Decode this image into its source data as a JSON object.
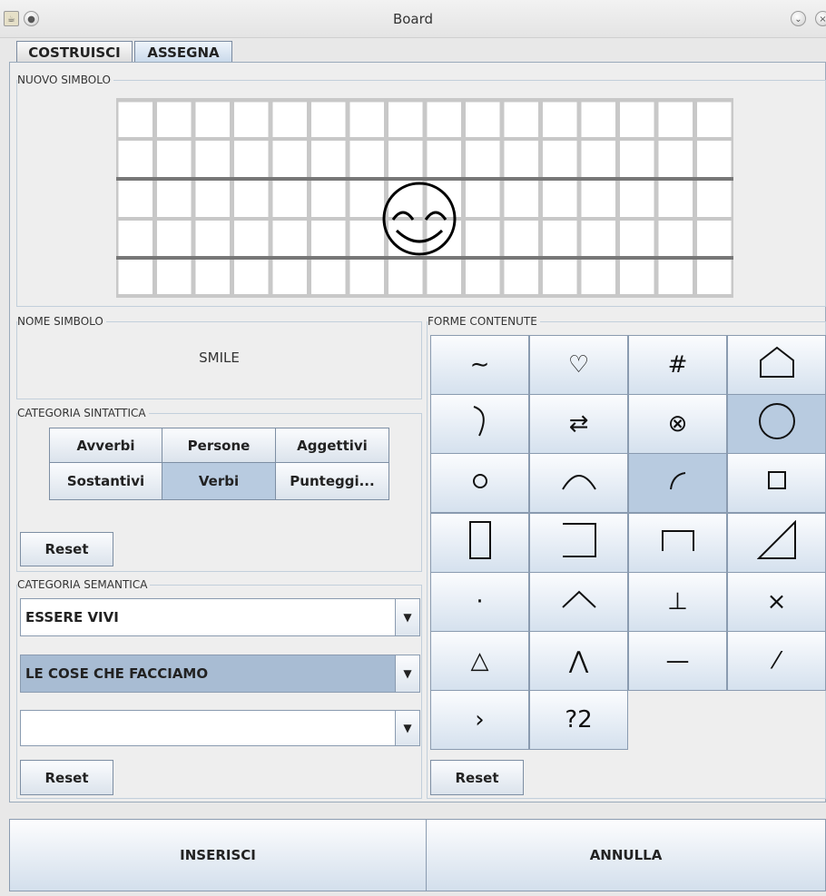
{
  "window": {
    "title": "Board"
  },
  "tabs": [
    {
      "label": "COSTRUISCI"
    },
    {
      "label": "ASSEGNA"
    }
  ],
  "nuovo_simbolo": {
    "legend": "NUOVO SIMBOLO",
    "grid_columns": 16
  },
  "nome_simbolo": {
    "legend": "NOME SIMBOLO",
    "value": "SMILE"
  },
  "categoria_sintattica": {
    "legend": "CATEGORIA SINTATTICA",
    "buttons": [
      "Avverbi",
      "Persone",
      "Aggettivi",
      "Sostantivi",
      "Verbi",
      "Punteggi..."
    ],
    "selected": "Verbi",
    "reset_label": "Reset"
  },
  "categoria_semantica": {
    "legend": "CATEGORIA SEMANTICA",
    "combos": [
      "ESSERE VIVI",
      "LE COSE CHE FACCIAMO",
      ""
    ],
    "selected_index": 1,
    "reset_label": "Reset"
  },
  "forme_contenute": {
    "legend": "FORME CONTENUTE",
    "shapes": [
      {
        "icon": "tilde-icon",
        "glyph": "∼"
      },
      {
        "icon": "heart-outline-icon",
        "glyph": "♡"
      },
      {
        "icon": "hash-icon",
        "glyph": "#"
      },
      {
        "icon": "house-outline-icon",
        "glyph": ""
      },
      {
        "icon": "right-arc-icon",
        "glyph": ""
      },
      {
        "icon": "swap-arrows-icon",
        "glyph": "⇄"
      },
      {
        "icon": "circled-times-icon",
        "glyph": "⊗"
      },
      {
        "icon": "large-circle-icon",
        "glyph": ""
      },
      {
        "icon": "small-circle-icon",
        "glyph": ""
      },
      {
        "icon": "upper-arc-icon",
        "glyph": ""
      },
      {
        "icon": "corner-arc-icon",
        "glyph": ""
      },
      {
        "icon": "small-square-icon",
        "glyph": ""
      },
      {
        "icon": "tall-rectangle-icon",
        "glyph": ""
      },
      {
        "icon": "right-bracket-icon",
        "glyph": ""
      },
      {
        "icon": "table-shape-icon",
        "glyph": ""
      },
      {
        "icon": "right-triangle-icon",
        "glyph": ""
      },
      {
        "icon": "dot-icon",
        "glyph": "·"
      },
      {
        "icon": "caret-up-icon",
        "glyph": ""
      },
      {
        "icon": "perpendicular-icon",
        "glyph": "⊥"
      },
      {
        "icon": "times-icon",
        "glyph": "×"
      },
      {
        "icon": "triangle-outline-icon",
        "glyph": "△"
      },
      {
        "icon": "lambda-shape-icon",
        "glyph": "⋀"
      },
      {
        "icon": "horizontal-line-icon",
        "glyph": "—"
      },
      {
        "icon": "short-slash-icon",
        "glyph": "⁄"
      },
      {
        "icon": "greater-than-icon",
        "glyph": "›"
      },
      {
        "icon": "unknown-icon",
        "glyph": "?2"
      }
    ],
    "selected": [
      "large-circle-icon",
      "corner-arc-icon"
    ],
    "reset_label": "Reset"
  },
  "actions": {
    "insert_label": "INSERISCI",
    "cancel_label": "ANNULLA"
  }
}
